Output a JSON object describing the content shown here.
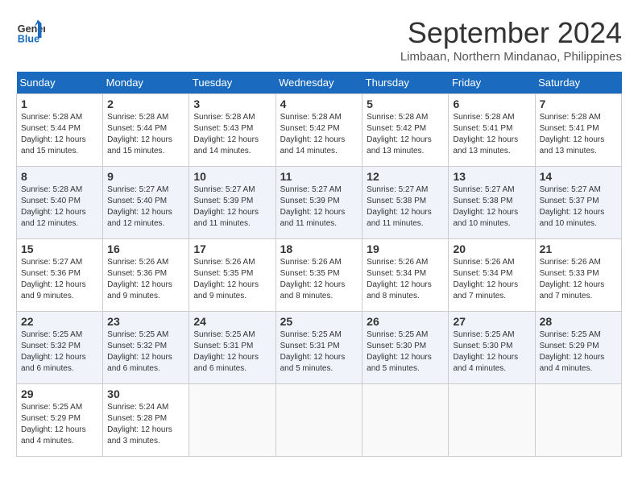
{
  "header": {
    "logo_line1": "General",
    "logo_line2": "Blue",
    "month_title": "September 2024",
    "subtitle": "Limbaan, Northern Mindanao, Philippines"
  },
  "weekdays": [
    "Sunday",
    "Monday",
    "Tuesday",
    "Wednesday",
    "Thursday",
    "Friday",
    "Saturday"
  ],
  "weeks": [
    [
      {
        "day": "1",
        "sunrise": "Sunrise: 5:28 AM",
        "sunset": "Sunset: 5:44 PM",
        "daylight": "Daylight: 12 hours and 15 minutes."
      },
      {
        "day": "2",
        "sunrise": "Sunrise: 5:28 AM",
        "sunset": "Sunset: 5:44 PM",
        "daylight": "Daylight: 12 hours and 15 minutes."
      },
      {
        "day": "3",
        "sunrise": "Sunrise: 5:28 AM",
        "sunset": "Sunset: 5:43 PM",
        "daylight": "Daylight: 12 hours and 14 minutes."
      },
      {
        "day": "4",
        "sunrise": "Sunrise: 5:28 AM",
        "sunset": "Sunset: 5:42 PM",
        "daylight": "Daylight: 12 hours and 14 minutes."
      },
      {
        "day": "5",
        "sunrise": "Sunrise: 5:28 AM",
        "sunset": "Sunset: 5:42 PM",
        "daylight": "Daylight: 12 hours and 13 minutes."
      },
      {
        "day": "6",
        "sunrise": "Sunrise: 5:28 AM",
        "sunset": "Sunset: 5:41 PM",
        "daylight": "Daylight: 12 hours and 13 minutes."
      },
      {
        "day": "7",
        "sunrise": "Sunrise: 5:28 AM",
        "sunset": "Sunset: 5:41 PM",
        "daylight": "Daylight: 12 hours and 13 minutes."
      }
    ],
    [
      {
        "day": "8",
        "sunrise": "Sunrise: 5:28 AM",
        "sunset": "Sunset: 5:40 PM",
        "daylight": "Daylight: 12 hours and 12 minutes."
      },
      {
        "day": "9",
        "sunrise": "Sunrise: 5:27 AM",
        "sunset": "Sunset: 5:40 PM",
        "daylight": "Daylight: 12 hours and 12 minutes."
      },
      {
        "day": "10",
        "sunrise": "Sunrise: 5:27 AM",
        "sunset": "Sunset: 5:39 PM",
        "daylight": "Daylight: 12 hours and 11 minutes."
      },
      {
        "day": "11",
        "sunrise": "Sunrise: 5:27 AM",
        "sunset": "Sunset: 5:39 PM",
        "daylight": "Daylight: 12 hours and 11 minutes."
      },
      {
        "day": "12",
        "sunrise": "Sunrise: 5:27 AM",
        "sunset": "Sunset: 5:38 PM",
        "daylight": "Daylight: 12 hours and 11 minutes."
      },
      {
        "day": "13",
        "sunrise": "Sunrise: 5:27 AM",
        "sunset": "Sunset: 5:38 PM",
        "daylight": "Daylight: 12 hours and 10 minutes."
      },
      {
        "day": "14",
        "sunrise": "Sunrise: 5:27 AM",
        "sunset": "Sunset: 5:37 PM",
        "daylight": "Daylight: 12 hours and 10 minutes."
      }
    ],
    [
      {
        "day": "15",
        "sunrise": "Sunrise: 5:27 AM",
        "sunset": "Sunset: 5:36 PM",
        "daylight": "Daylight: 12 hours and 9 minutes."
      },
      {
        "day": "16",
        "sunrise": "Sunrise: 5:26 AM",
        "sunset": "Sunset: 5:36 PM",
        "daylight": "Daylight: 12 hours and 9 minutes."
      },
      {
        "day": "17",
        "sunrise": "Sunrise: 5:26 AM",
        "sunset": "Sunset: 5:35 PM",
        "daylight": "Daylight: 12 hours and 9 minutes."
      },
      {
        "day": "18",
        "sunrise": "Sunrise: 5:26 AM",
        "sunset": "Sunset: 5:35 PM",
        "daylight": "Daylight: 12 hours and 8 minutes."
      },
      {
        "day": "19",
        "sunrise": "Sunrise: 5:26 AM",
        "sunset": "Sunset: 5:34 PM",
        "daylight": "Daylight: 12 hours and 8 minutes."
      },
      {
        "day": "20",
        "sunrise": "Sunrise: 5:26 AM",
        "sunset": "Sunset: 5:34 PM",
        "daylight": "Daylight: 12 hours and 7 minutes."
      },
      {
        "day": "21",
        "sunrise": "Sunrise: 5:26 AM",
        "sunset": "Sunset: 5:33 PM",
        "daylight": "Daylight: 12 hours and 7 minutes."
      }
    ],
    [
      {
        "day": "22",
        "sunrise": "Sunrise: 5:25 AM",
        "sunset": "Sunset: 5:32 PM",
        "daylight": "Daylight: 12 hours and 6 minutes."
      },
      {
        "day": "23",
        "sunrise": "Sunrise: 5:25 AM",
        "sunset": "Sunset: 5:32 PM",
        "daylight": "Daylight: 12 hours and 6 minutes."
      },
      {
        "day": "24",
        "sunrise": "Sunrise: 5:25 AM",
        "sunset": "Sunset: 5:31 PM",
        "daylight": "Daylight: 12 hours and 6 minutes."
      },
      {
        "day": "25",
        "sunrise": "Sunrise: 5:25 AM",
        "sunset": "Sunset: 5:31 PM",
        "daylight": "Daylight: 12 hours and 5 minutes."
      },
      {
        "day": "26",
        "sunrise": "Sunrise: 5:25 AM",
        "sunset": "Sunset: 5:30 PM",
        "daylight": "Daylight: 12 hours and 5 minutes."
      },
      {
        "day": "27",
        "sunrise": "Sunrise: 5:25 AM",
        "sunset": "Sunset: 5:30 PM",
        "daylight": "Daylight: 12 hours and 4 minutes."
      },
      {
        "day": "28",
        "sunrise": "Sunrise: 5:25 AM",
        "sunset": "Sunset: 5:29 PM",
        "daylight": "Daylight: 12 hours and 4 minutes."
      }
    ],
    [
      {
        "day": "29",
        "sunrise": "Sunrise: 5:25 AM",
        "sunset": "Sunset: 5:29 PM",
        "daylight": "Daylight: 12 hours and 4 minutes."
      },
      {
        "day": "30",
        "sunrise": "Sunrise: 5:24 AM",
        "sunset": "Sunset: 5:28 PM",
        "daylight": "Daylight: 12 hours and 3 minutes."
      },
      null,
      null,
      null,
      null,
      null
    ]
  ]
}
